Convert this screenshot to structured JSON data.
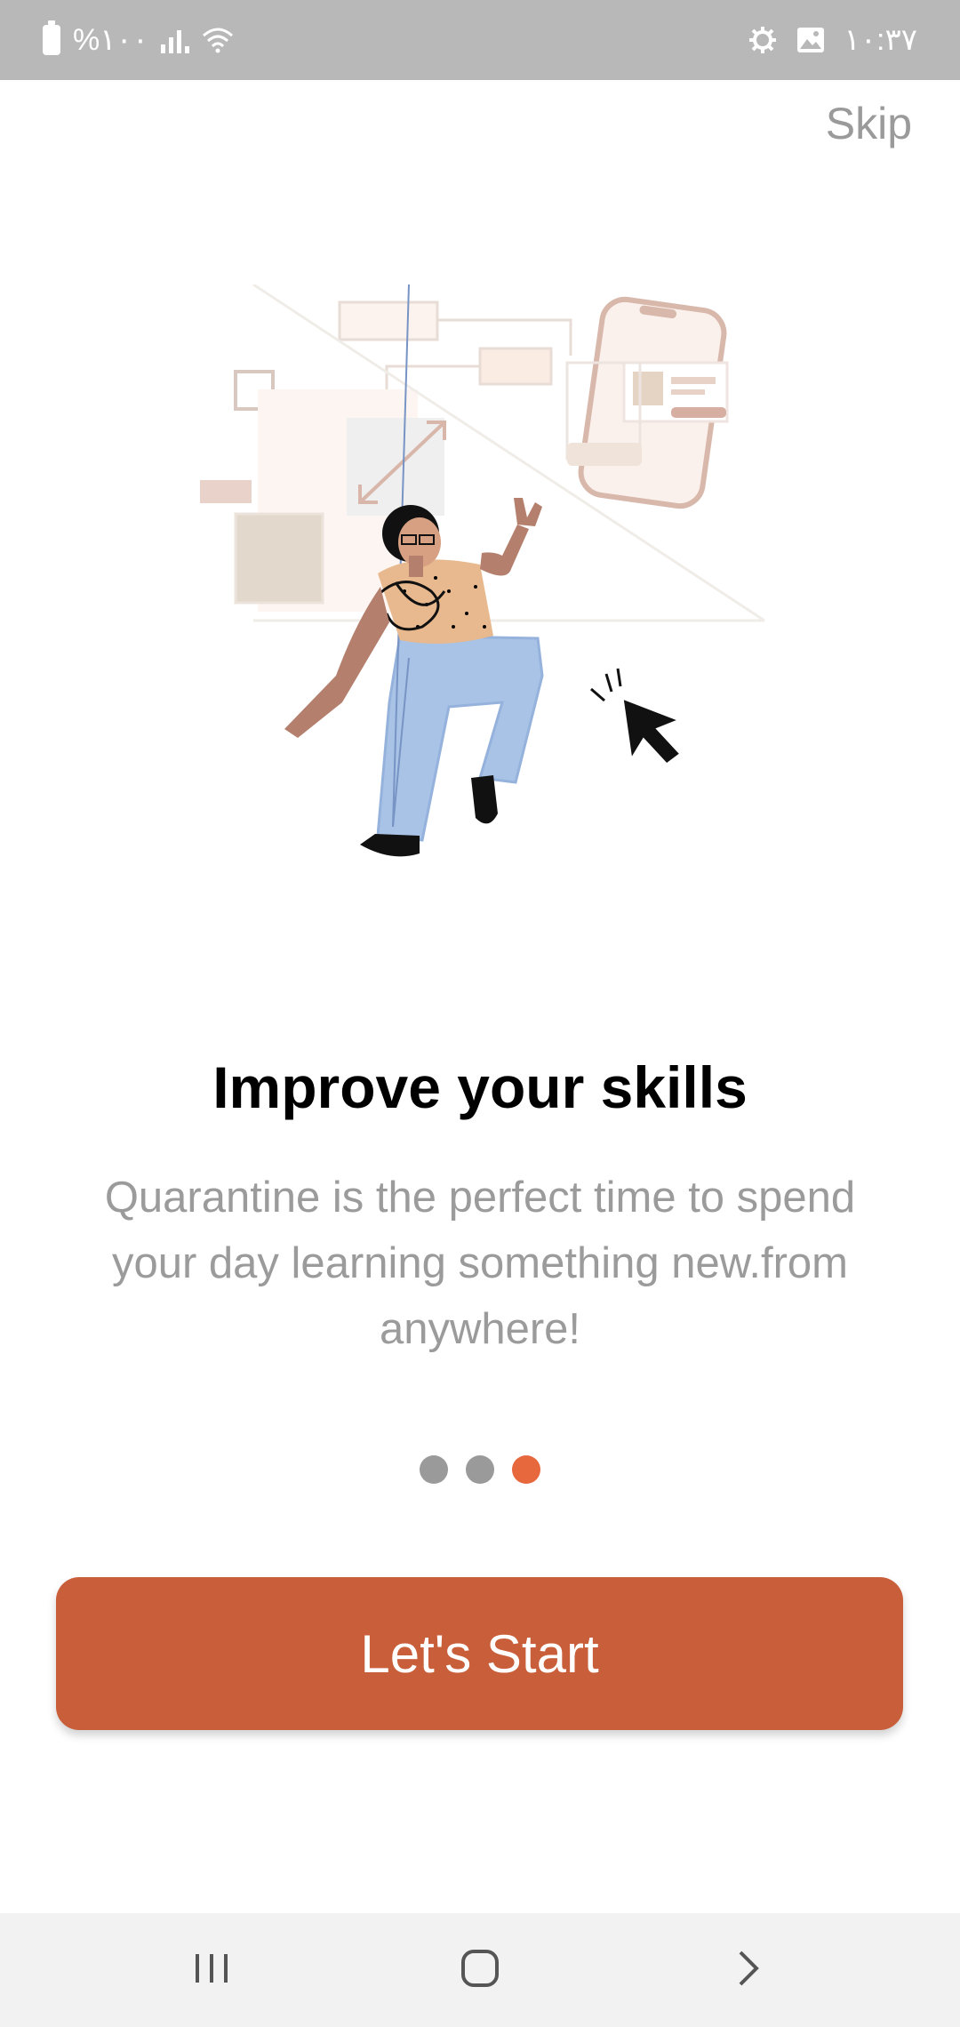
{
  "status_bar": {
    "battery": "%۱۰۰",
    "time": "۱۰:۳۷"
  },
  "header": {
    "skip_label": "Skip"
  },
  "onboarding": {
    "title": "Improve your skills",
    "description": "Quarantine is the perfect time to spend your day learning something new.from anywhere!",
    "page_count": 3,
    "current_page": 3
  },
  "actions": {
    "start_label": "Let's Start"
  },
  "colors": {
    "accent": "#c95f3a",
    "active_dot": "#e8683d",
    "inactive_dot": "#9a9a9a",
    "status_bar": "#b8b8b8"
  },
  "icons": {
    "status": [
      "battery-icon",
      "signal-icon",
      "wifi-icon",
      "gear-icon",
      "gallery-icon"
    ],
    "nav": [
      "recents-icon",
      "home-icon",
      "back-icon"
    ]
  }
}
